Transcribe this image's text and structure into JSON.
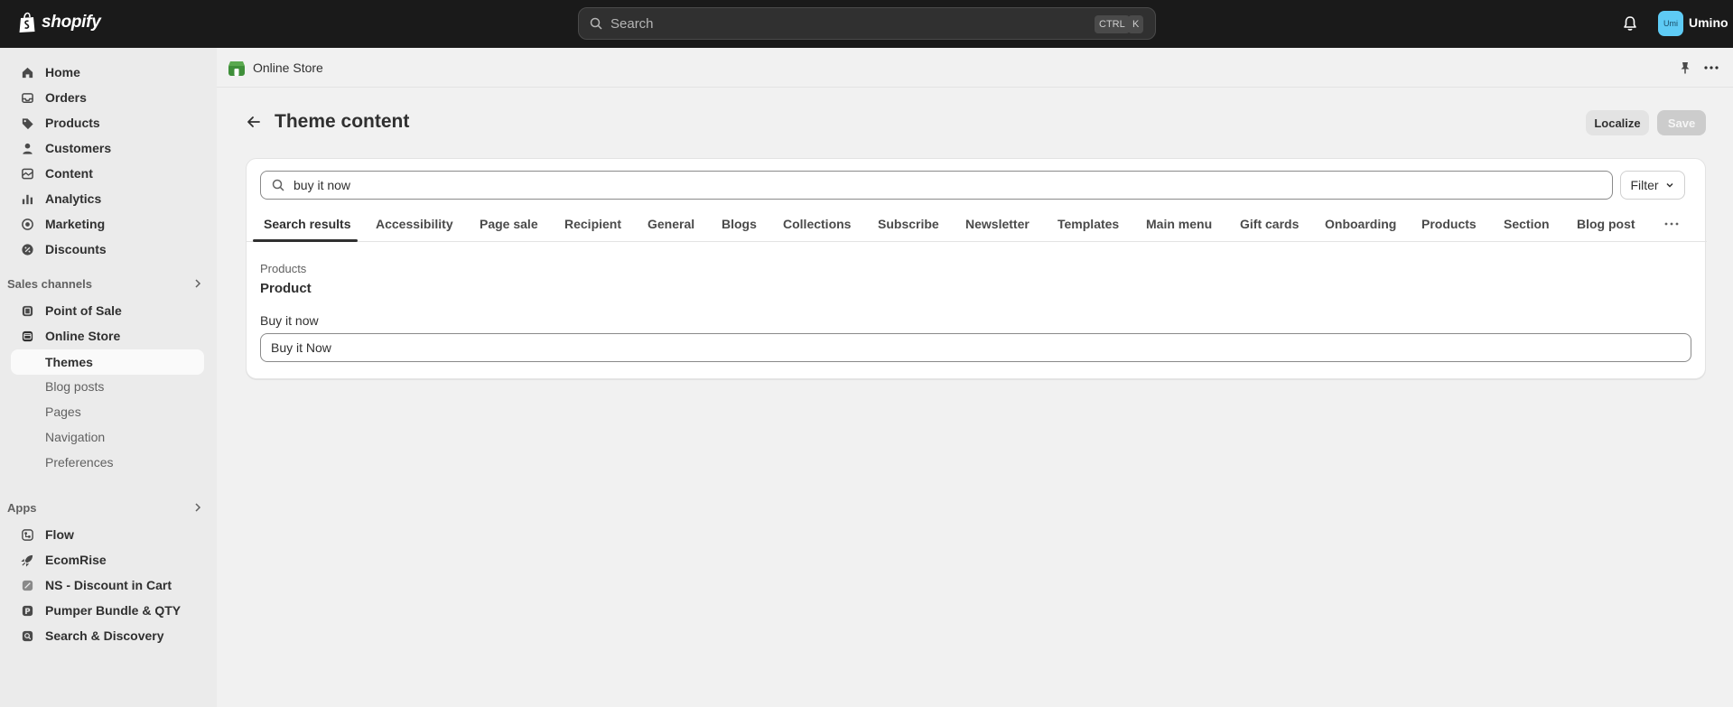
{
  "topbar": {
    "brand": "shopify",
    "search_placeholder": "Search",
    "shortcut_ctrl": "CTRL",
    "shortcut_k": "K",
    "avatar_initials": "Umi",
    "user_name": "Umino"
  },
  "sidebar": {
    "main_items": [
      {
        "label": "Home",
        "icon": "home-icon"
      },
      {
        "label": "Orders",
        "icon": "inbox-icon"
      },
      {
        "label": "Products",
        "icon": "tag-icon"
      },
      {
        "label": "Customers",
        "icon": "person-icon"
      },
      {
        "label": "Content",
        "icon": "content-icon"
      },
      {
        "label": "Analytics",
        "icon": "bar-chart-icon"
      },
      {
        "label": "Marketing",
        "icon": "target-icon"
      },
      {
        "label": "Discounts",
        "icon": "discount-icon"
      }
    ],
    "sales_channels_label": "Sales channels",
    "sales_channels": [
      {
        "label": "Point of Sale",
        "icon": "pos-icon"
      },
      {
        "label": "Online Store",
        "icon": "store-icon"
      }
    ],
    "online_store_sub": [
      "Themes",
      "Blog posts",
      "Pages",
      "Navigation",
      "Preferences"
    ],
    "apps_label": "Apps",
    "apps": [
      {
        "label": "Flow",
        "icon": "flow-icon"
      },
      {
        "label": "EcomRise",
        "icon": "rocket-icon"
      },
      {
        "label": "NS - Discount in Cart",
        "icon": "ns-app-icon"
      },
      {
        "label": "Pumper Bundle & QTY",
        "icon": "pumper-app-icon"
      },
      {
        "label": "Search & Discovery",
        "icon": "search-discovery-icon"
      }
    ]
  },
  "subbar": {
    "title": "Online Store"
  },
  "page": {
    "title": "Theme content",
    "localize_label": "Localize",
    "save_label": "Save"
  },
  "card": {
    "search_value": "buy it now",
    "filter_label": "Filter",
    "tabs": [
      "Search results",
      "Accessibility",
      "Page sale",
      "Recipient",
      "General",
      "Blogs",
      "Collections",
      "Subscribe",
      "Newsletter",
      "Templates",
      "Main menu",
      "Gift cards",
      "Onboarding",
      "Products",
      "Section",
      "Blog post"
    ],
    "active_tab": "Search results",
    "result_section": "Products",
    "result_title": "Product",
    "field_label": "Buy it now",
    "field_value": "Buy it Now"
  },
  "colors": {
    "topbar_bg": "#1a1a1a",
    "page_bg": "#f1f1f1",
    "avatar_bg": "#5ecbf5",
    "store_icon_green": "#3f8f3a"
  }
}
